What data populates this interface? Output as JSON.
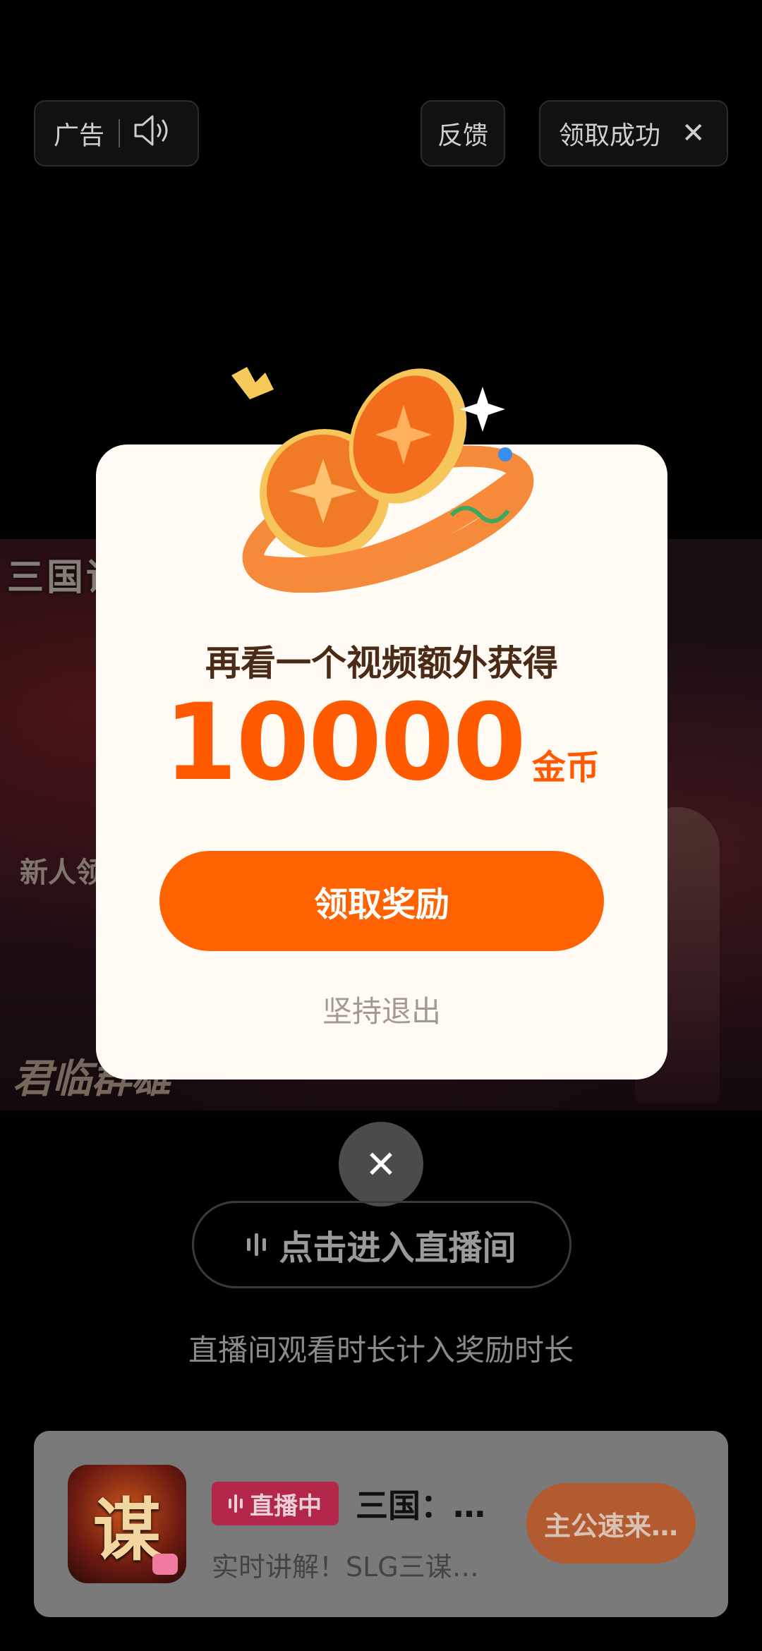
{
  "top_bar": {
    "ad_label": "广告",
    "speaker_icon": "speaker-icon",
    "feedback_label": "反馈",
    "reward_status": "领取成功",
    "close_icon": "close-icon"
  },
  "video": {
    "logo_text": "三国谋定",
    "sub_text": "新人领",
    "footer_text": "君临群雄"
  },
  "modal": {
    "art_icon": "coin-ribbon-icon",
    "subtitle": "再看一个视频额外获得",
    "amount": "10000",
    "unit": "金币",
    "claim_button": "领取奖励",
    "quit_link": "坚持退出",
    "close_icon": "close-icon"
  },
  "live_entry": {
    "button_label": "点击进入直播间",
    "hint": "直播间观看时长计入奖励时长"
  },
  "ad_card": {
    "icon_glyph": "谋",
    "live_badge": "直播中",
    "title": "三国：…",
    "description": "实时讲解！SLG三谋…",
    "cta_label": "主公速来…"
  },
  "colors": {
    "accent": "#ff6200",
    "modal_bg": "#fffaf3",
    "live_badge": "#b2274a"
  }
}
